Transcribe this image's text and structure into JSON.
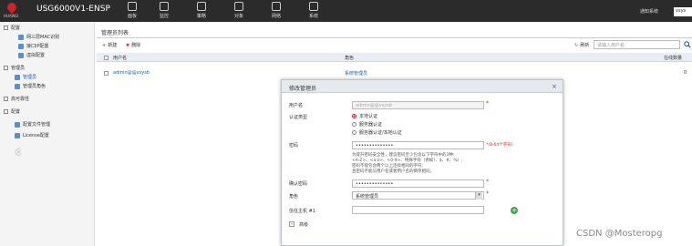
{
  "topbar": {
    "logo_text": "HUAWEI",
    "device": "USG6000V1-ENSP",
    "nav": [
      {
        "label": "面板",
        "icon": "dashboard-icon"
      },
      {
        "label": "监控",
        "icon": "monitor-icon"
      },
      {
        "label": "策略",
        "icon": "policy-icon"
      },
      {
        "label": "对象",
        "icon": "object-icon"
      },
      {
        "label": "网络",
        "icon": "network-icon"
      },
      {
        "label": "系统",
        "icon": "system-icon"
      }
    ],
    "link": "通知系统",
    "user": "vsys"
  },
  "sidebar": {
    "items": [
      {
        "label": "配置",
        "type": "group"
      },
      {
        "label": "网三层MAC识别",
        "type": "item"
      },
      {
        "label": "接口IP配置",
        "type": "item"
      },
      {
        "label": "虚拟配置",
        "type": "item"
      },
      {
        "label": "管理员",
        "type": "group"
      },
      {
        "label": "管理员",
        "type": "item",
        "active": true
      },
      {
        "label": "管理员角色",
        "type": "item"
      },
      {
        "label": "高可靠性",
        "type": "group"
      },
      {
        "label": "配置",
        "type": "group"
      },
      {
        "label": "配置文件管理",
        "type": "item"
      },
      {
        "label": "License配置",
        "type": "item"
      }
    ]
  },
  "main": {
    "title": "管理员列表",
    "new_label": "新建",
    "delete_label": "删除",
    "refresh_label": "刷新",
    "search_placeholder": "请输入用户名",
    "columns": [
      "用户名",
      "角色",
      "在线数量"
    ],
    "rows": [
      {
        "user": "admin@@vsysb",
        "role": "系统管理员",
        "online": "0"
      }
    ]
  },
  "modal": {
    "title": "修改管理员",
    "close": "×",
    "username_label": "用户名",
    "username_value": "admin@@vsysb",
    "auth_label": "认证类型",
    "auth_options": [
      "本地认证",
      "服务器认证",
      "服务器认证/本地认证"
    ],
    "auth_selected": 0,
    "password_label": "密码",
    "password_value": "••••••••••••••",
    "password_hint_range": "*(8-64个字符)",
    "password_hint_lines": [
      "为提升密码安全性，建议密码至少包含以下字符中的3种:",
      "<A-Z>、<a-z>、<0-9>、特殊字符（例如!、$、#、%）;",
      "密码不能包含两个以上连续相同的字符;",
      "且密码不能与用户名或者用户名的倒序相同。"
    ],
    "confirm_label": "确认密码",
    "confirm_value": "••••••••••••••",
    "role_label": "角色",
    "role_value": "系统管理员",
    "trusted_host_label": "信任主机 #1",
    "advanced_label": "高级"
  },
  "watermark": "CSDN @Mosteropg",
  "colors": {
    "topbar": "#2b2b2b",
    "accent": "#1a5fb4",
    "required": "#dd2222",
    "add": "#3aa843"
  }
}
